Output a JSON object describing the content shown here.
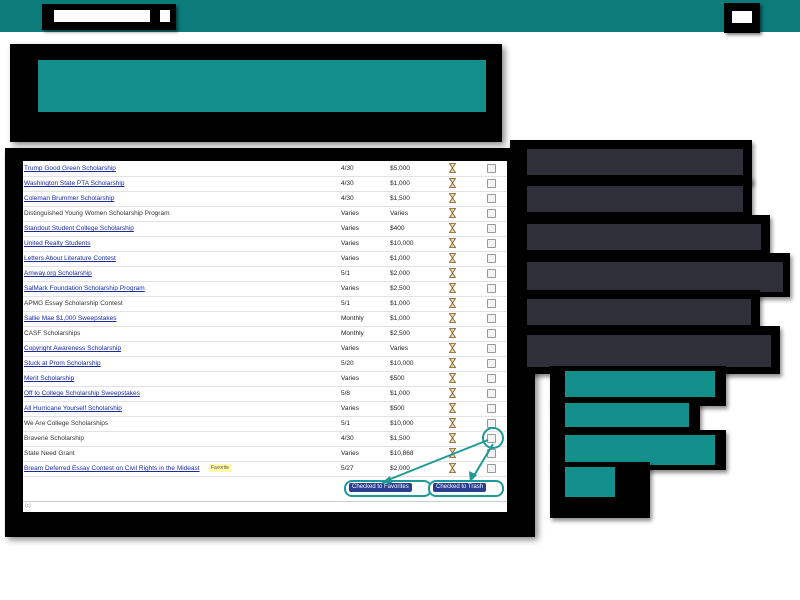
{
  "table": {
    "rows": [
      {
        "name": "Trump Good Green Scholarship",
        "deadline": "4/30",
        "amount": "$5,000",
        "link": true
      },
      {
        "name": "Washington State PTA Scholarship",
        "deadline": "4/30",
        "amount": "$1,000",
        "link": true
      },
      {
        "name": "Coleman Brummer Scholarship",
        "deadline": "4/30",
        "amount": "$1,500",
        "link": true
      },
      {
        "name": "Distinguished Young Women Scholarship Program",
        "deadline": "Varies",
        "amount": "Varies",
        "link": false
      },
      {
        "name": "Standout Student College Scholarship",
        "deadline": "Varies",
        "amount": "$400",
        "link": true
      },
      {
        "name": "United Realty Students",
        "deadline": "Varies",
        "amount": "$10,000",
        "link": true
      },
      {
        "name": "Letters About Literature Contest",
        "deadline": "Varies",
        "amount": "$1,000",
        "link": true
      },
      {
        "name": "Amway.org Scholarship",
        "deadline": "5/1",
        "amount": "$2,000",
        "link": true
      },
      {
        "name": "SalMark Foundation Scholarship Program",
        "deadline": "Varies",
        "amount": "$2,500",
        "link": true
      },
      {
        "name": "APMG Essay Scholarship Contest",
        "deadline": "5/1",
        "amount": "$1,000",
        "link": false
      },
      {
        "name": "Sallie Mae $1,000 Sweepstakes",
        "deadline": "Monthly",
        "amount": "$1,000",
        "link": true
      },
      {
        "name": "CASF Scholarships",
        "deadline": "Monthly",
        "amount": "$2,500",
        "link": false
      },
      {
        "name": "Copyright Awareness Scholarship",
        "deadline": "Varies",
        "amount": "Varies",
        "link": true
      },
      {
        "name": "Stuck at Prom Scholarship",
        "deadline": "5/20",
        "amount": "$10,000",
        "link": true
      },
      {
        "name": "Merit Scholarship",
        "deadline": "Varies",
        "amount": "$500",
        "link": true
      },
      {
        "name": "Off to College Scholarship Sweepstakes",
        "deadline": "5/8",
        "amount": "$1,000",
        "link": true
      },
      {
        "name": "All Hurricane Yourself Scholarship",
        "deadline": "Varies",
        "amount": "$500",
        "link": true
      },
      {
        "name": "We Are College Scholarships",
        "deadline": "5/1",
        "amount": "$10,000",
        "link": false
      },
      {
        "name": "Braverie Scholarship",
        "deadline": "4/30",
        "amount": "$1,500",
        "link": false
      },
      {
        "name": "State Need Grant",
        "deadline": "Varies",
        "amount": "$10,868",
        "link": false
      },
      {
        "name": "Bream Deferred Essay Contest on Civil Rights in the Mideast",
        "deadline": "5/27",
        "amount": "$2,000",
        "link": true,
        "badge": "Favorite"
      }
    ]
  },
  "actions": {
    "favorites_label": "Checked to Favorites",
    "trash_label": "Checked to Trash"
  },
  "colors": {
    "accent": "#0b7c7a",
    "teal": "#138f8c",
    "dark_slate": "#2e2f38",
    "link": "#1a2aa0",
    "button": "#2a3f8f"
  },
  "icons": {
    "row_status": "hourglass-icon",
    "row_select": "checkbox"
  }
}
